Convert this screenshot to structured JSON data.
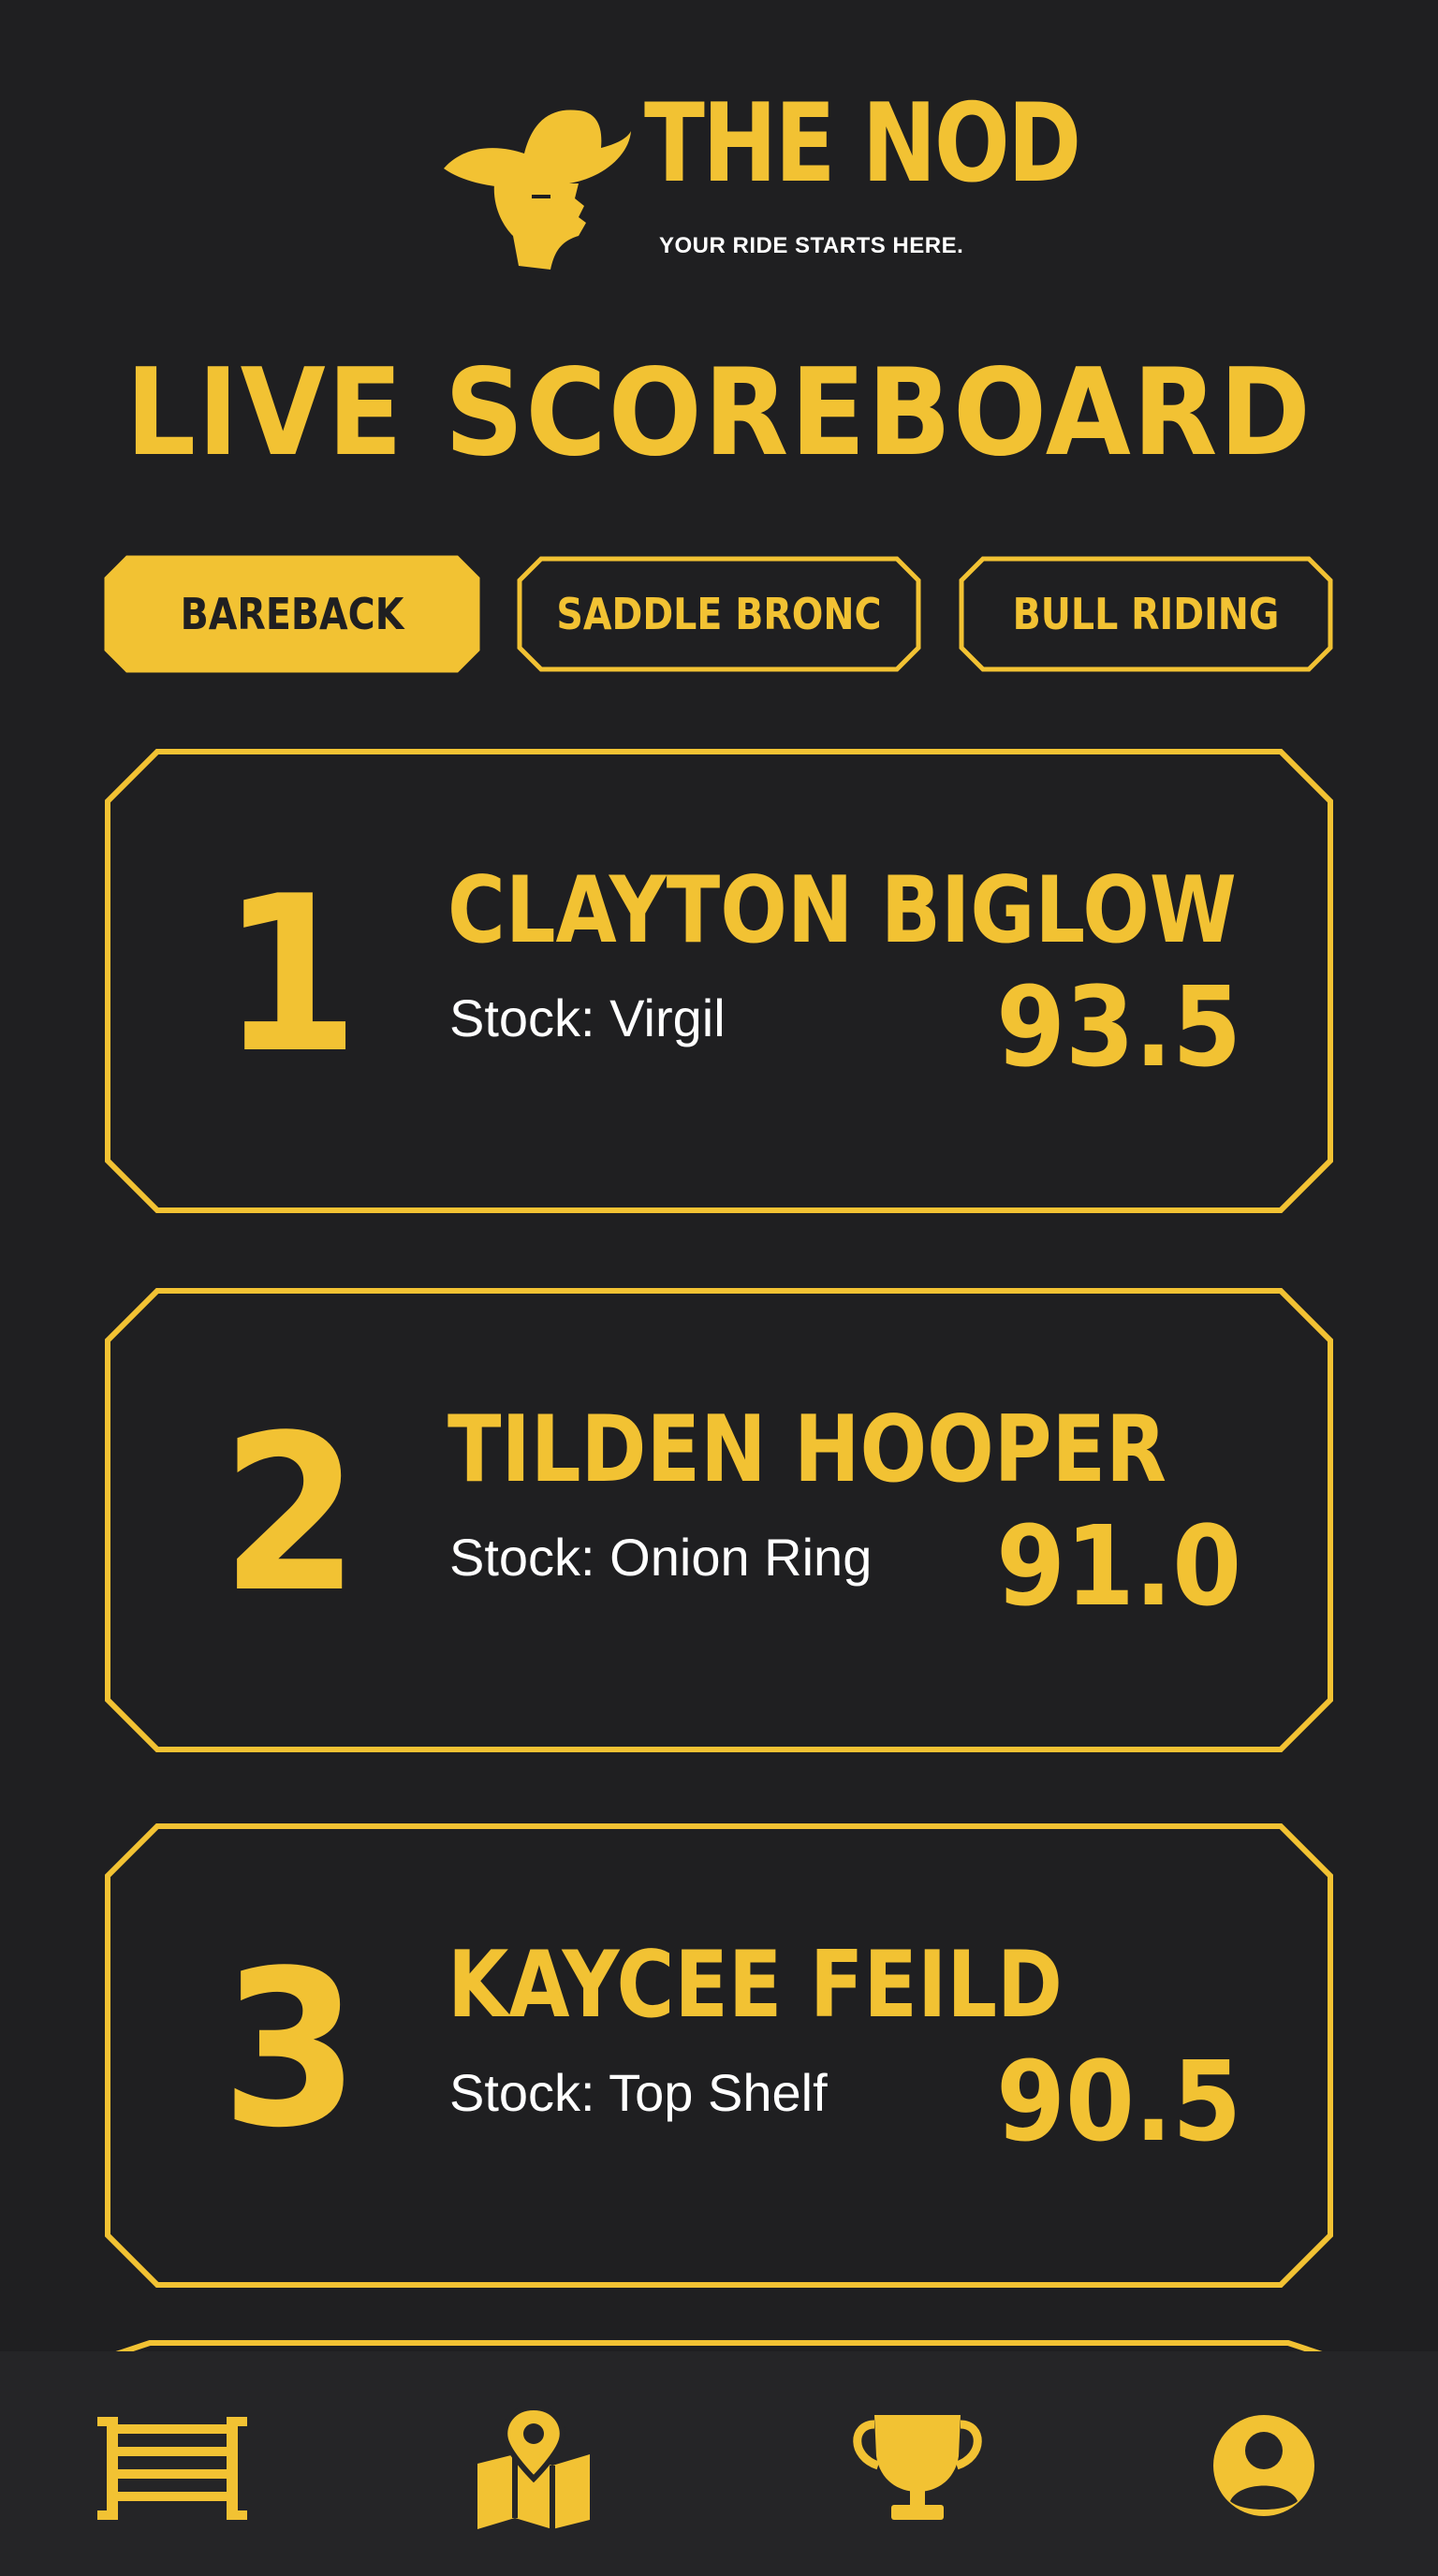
{
  "brand": {
    "name": "THE NOD",
    "tagline": "YOUR RIDE STARTS HERE."
  },
  "page": {
    "title": "LIVE SCOREBOARD"
  },
  "tabs": [
    {
      "label": "BAREBACK",
      "active": true
    },
    {
      "label": "SADDLE BRONC",
      "active": false
    },
    {
      "label": "BULL RIDING",
      "active": false
    }
  ],
  "leaderboard": [
    {
      "rank": "1",
      "name": "CLAYTON BIGLOW",
      "stock": "Stock: Virgil",
      "score": "93.5"
    },
    {
      "rank": "2",
      "name": "TILDEN HOOPER",
      "stock": "Stock: Onion Ring",
      "score": "91.0"
    },
    {
      "rank": "3",
      "name": "KAYCEE FEILD",
      "stock": "Stock: Top Shelf",
      "score": "90.5"
    }
  ],
  "bottom_nav": [
    {
      "icon": "rodeo-gate-icon"
    },
    {
      "icon": "map-pin-icon"
    },
    {
      "icon": "trophy-icon"
    },
    {
      "icon": "profile-icon"
    }
  ],
  "colors": {
    "background": "#1f1f21",
    "accent": "#f2c233",
    "text_light": "#ffffff",
    "nav_background": "#252527"
  }
}
